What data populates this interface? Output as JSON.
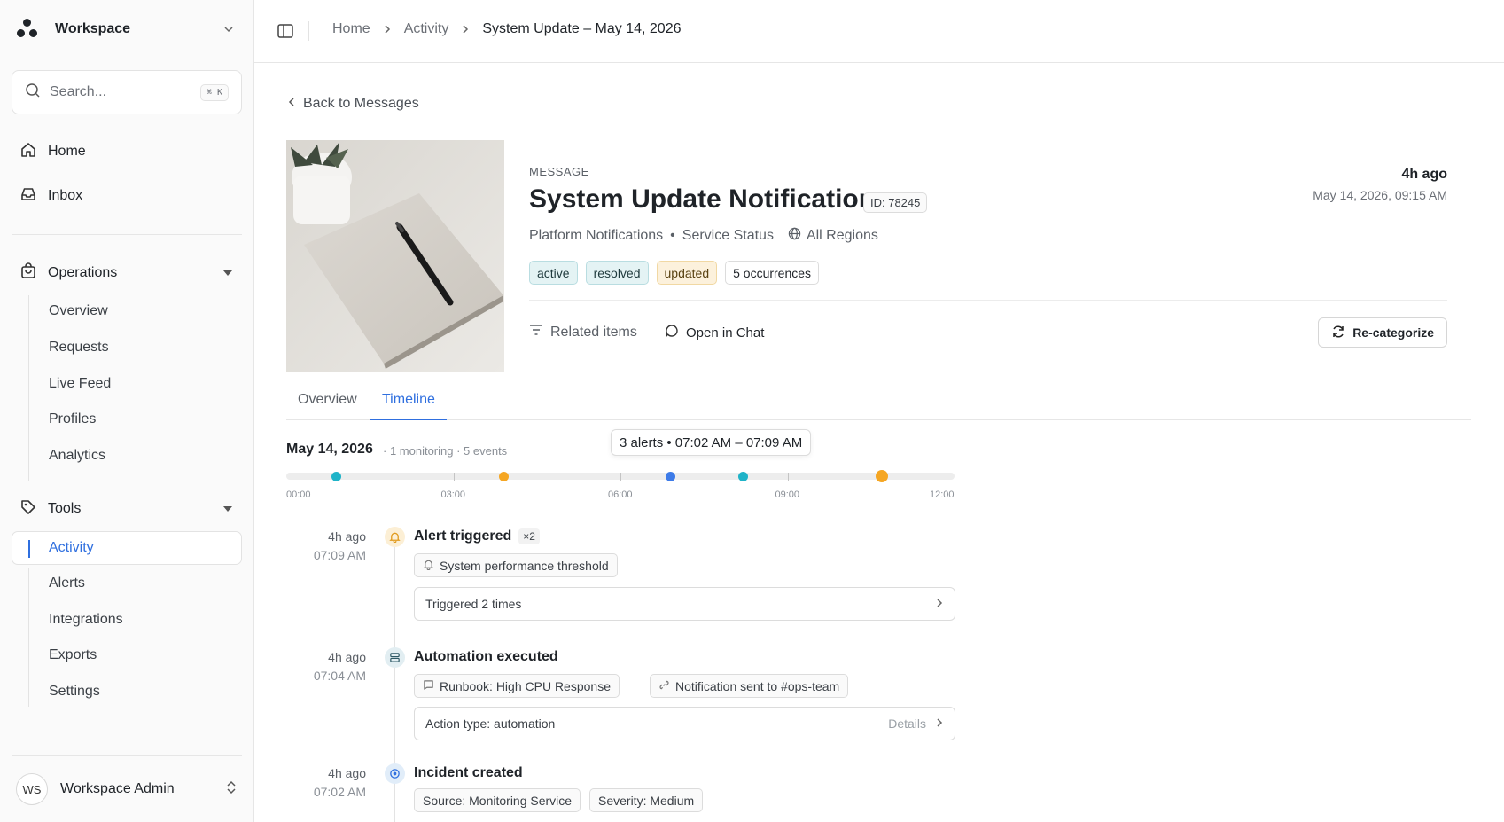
{
  "sidebar": {
    "workspace": "Workspace",
    "search_placeholder": "Search...",
    "search_shortcut": "⌘ K",
    "nav": [
      {
        "label": "Home",
        "icon": "home-icon"
      },
      {
        "label": "Inbox",
        "icon": "inbox-icon"
      }
    ],
    "operations": {
      "label": "Operations",
      "items": [
        "Overview",
        "Requests",
        "Live Feed",
        "Profiles",
        "Analytics"
      ]
    },
    "tools": {
      "label": "Tools",
      "active": "Activity",
      "items": [
        "Alerts",
        "Integrations",
        "Exports",
        "Settings"
      ]
    },
    "user": {
      "initials": "WS",
      "name": "Workspace Admin"
    }
  },
  "breadcrumbs": [
    "Home",
    "Activity",
    "System Update – May 14, 2026"
  ],
  "back_label": "Back to Messages",
  "message": {
    "kicker": "MESSAGE",
    "title": "System Update Notification",
    "id": "ID: 78245",
    "source": "Platform Notifications",
    "category": "Service Status",
    "region": "All Regions",
    "tags": [
      "active",
      "resolved",
      "updated",
      "5 occurrences"
    ],
    "time_relative": "4h ago",
    "time_absolute": "May 14, 2026, 09:15 AM"
  },
  "actions": {
    "related": "Related items",
    "chat": "Open in Chat",
    "recategorize": "Re-categorize"
  },
  "tabs": [
    "Overview",
    "Timeline"
  ],
  "active_tab": "Timeline",
  "timeline": {
    "date": "May 14, 2026",
    "summary": "· 1 monitoring · 5 events",
    "tooltip": "3 alerts • 07:02 AM – 07:09 AM",
    "ticks": [
      "00:00",
      "03:00",
      "06:00",
      "09:00",
      "12:00"
    ],
    "range_hours": [
      0,
      12
    ],
    "markers": [
      {
        "hour": 0.9,
        "color": "#1fb3c8"
      },
      {
        "hour": 3.9,
        "color": "#f5a623"
      },
      {
        "hour": 6.9,
        "color": "#3d7be8"
      },
      {
        "hour": 8.2,
        "color": "#1fb3c8"
      },
      {
        "hour": 10.7,
        "color": "#f5a623",
        "large": true
      }
    ]
  },
  "events": [
    {
      "rel": "4h ago",
      "abs": "07:09 AM",
      "title": "Alert triggered",
      "count": "×2",
      "chips": [
        "System performance threshold"
      ],
      "row": "Triggered 2 times",
      "row_detail": ""
    },
    {
      "rel": "4h ago",
      "abs": "07:04 AM",
      "title": "Automation executed",
      "chips": [
        "Runbook: High CPU Response",
        "Notification sent to #ops-team"
      ],
      "row": "Action type: automation",
      "row_detail": "Details"
    },
    {
      "rel": "4h ago",
      "abs": "07:02 AM",
      "title": "Incident created",
      "chips": [
        "Source: Monitoring Service",
        "Severity: Medium"
      ]
    }
  ],
  "colors": {
    "accent": "#2f6fdf",
    "alert": "#f5a623",
    "teal": "#1fb3c8"
  }
}
